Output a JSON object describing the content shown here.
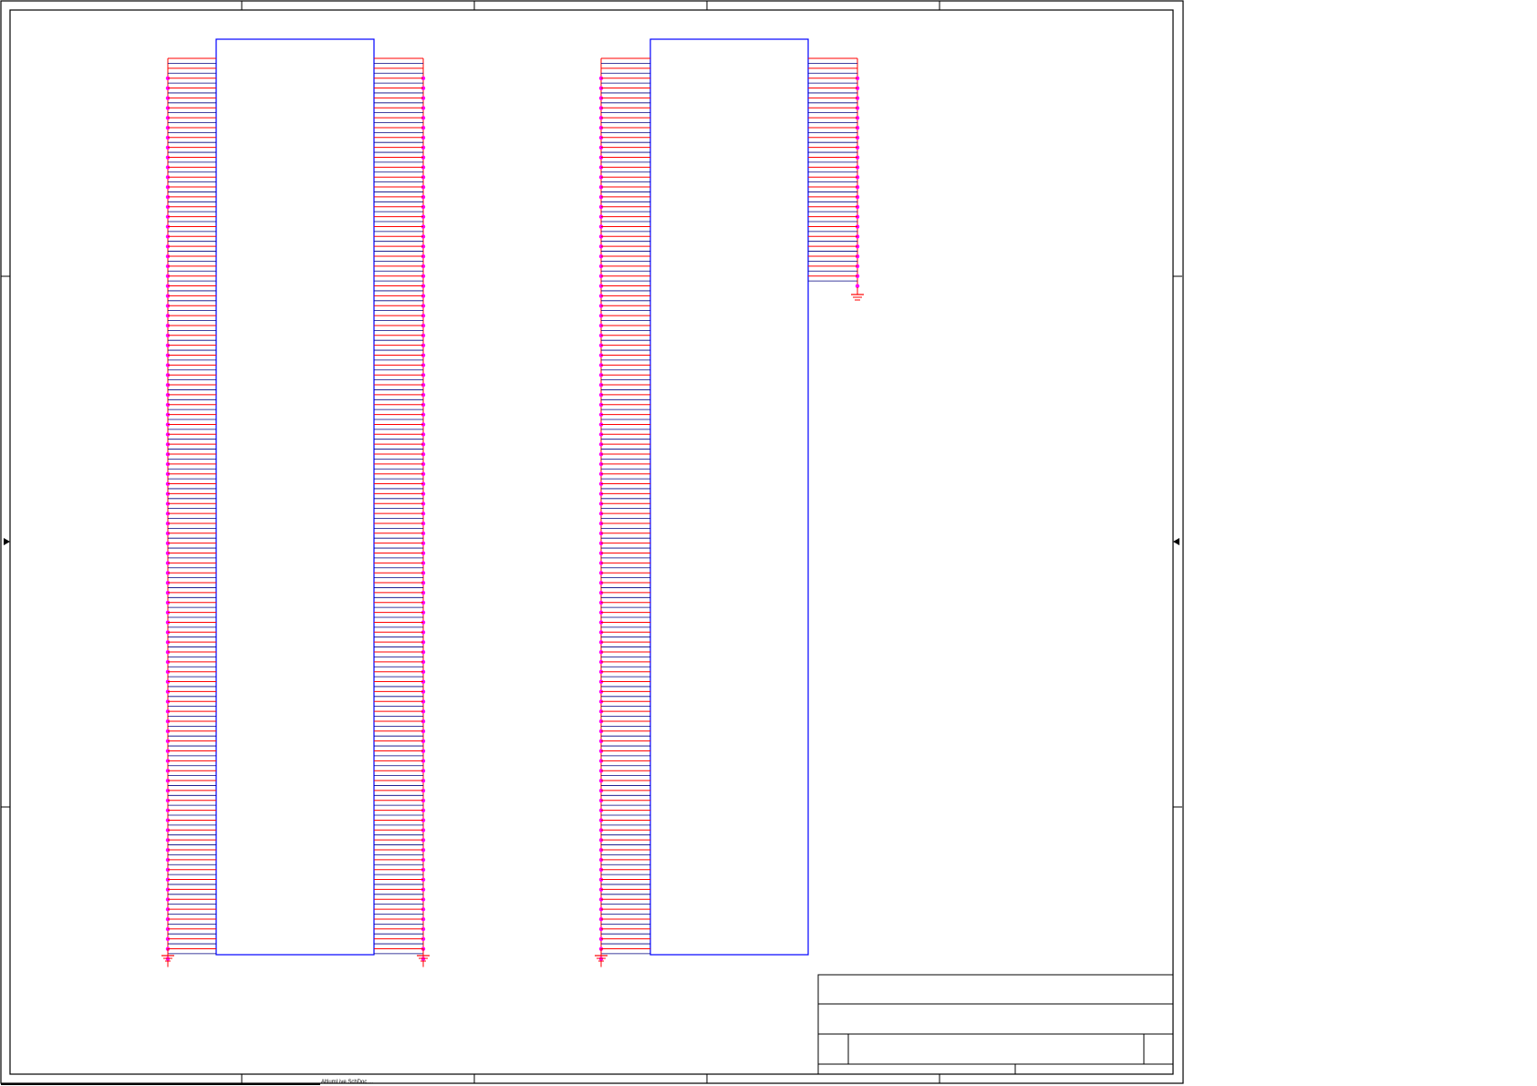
{
  "sheet": {
    "background": "#ffffff",
    "border_color": "#000000",
    "footer_text": "AltiumLive SchDoc  ..."
  },
  "colors": {
    "body": "#0000ff",
    "pin": "#ff0000",
    "wire": "#000080",
    "junction": "#ff00ff",
    "ground": "#ff0000",
    "frame": "#000000"
  },
  "components": [
    {
      "id": "connector-1",
      "left_pins": 90,
      "right_pins": 90
    },
    {
      "id": "connector-2",
      "left_pins": 90,
      "right_pins": 22
    }
  ],
  "symbols": {
    "ground_count": 4,
    "border_arrows": [
      "left-arrow-icon",
      "right-arrow-icon"
    ]
  },
  "title_block": {
    "title": "",
    "size": "",
    "number": "",
    "revision": "",
    "date": "",
    "file": "",
    "sheet": "",
    "drawn_by": ""
  }
}
